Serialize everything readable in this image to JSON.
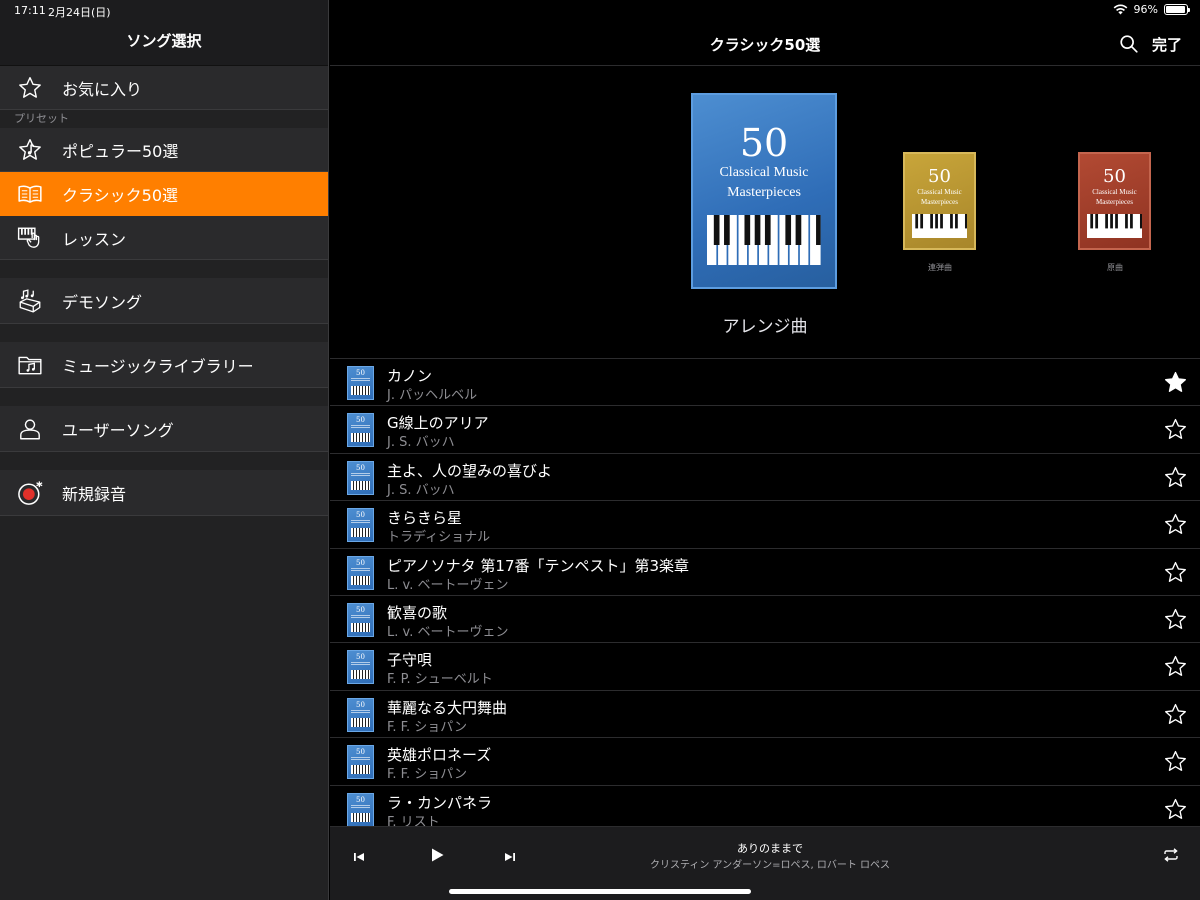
{
  "status": {
    "time": "17:11",
    "date": "2月24日(日)",
    "battery": "96%",
    "battery_level": 0.96
  },
  "sidebar": {
    "title": "ソング選択",
    "favorites": "お気に入り",
    "preset_section": "プリセット",
    "items": [
      {
        "label": "ポピュラー50選",
        "icon": "star-with-note-icon"
      },
      {
        "label": "クラシック50選",
        "icon": "book-icon",
        "active": true
      },
      {
        "label": "レッスン",
        "icon": "piano-hand-icon"
      },
      {
        "label": "デモソング",
        "icon": "music-notes-box-icon"
      },
      {
        "label": "ミュージックライブラリー",
        "icon": "folder-music-icon"
      },
      {
        "label": "ユーザーソング",
        "icon": "person-icon"
      },
      {
        "label": "新規録音",
        "icon": "record-icon"
      }
    ]
  },
  "main": {
    "title": "クラシック50選",
    "done_label": "完了",
    "accent_color": "#ff7f00",
    "albums": [
      {
        "num": "50",
        "line1": "Classical Music",
        "line2": "Masterpieces",
        "caption": ""
      },
      {
        "num": "50",
        "line1": "Classical Music",
        "line2": "Masterpieces",
        "caption": "連弾曲"
      },
      {
        "num": "50",
        "line1": "Classical Music",
        "line2": "Masterpieces",
        "caption": "原曲"
      }
    ],
    "selected_album_title": "アレンジ曲",
    "songs": [
      {
        "title": "カノン",
        "artist": "J. パッヘルベル",
        "favorite": true
      },
      {
        "title": "G線上のアリア",
        "artist": "J. S. バッハ",
        "favorite": false
      },
      {
        "title": "主よ、人の望みの喜びよ",
        "artist": "J. S. バッハ",
        "favorite": false
      },
      {
        "title": "きらきら星",
        "artist": "トラディショナル",
        "favorite": false
      },
      {
        "title": "ピアノソナタ 第17番「テンペスト」第3楽章",
        "artist": "L. v. ベートーヴェン",
        "favorite": false
      },
      {
        "title": "歓喜の歌",
        "artist": "L. v. ベートーヴェン",
        "favorite": false
      },
      {
        "title": "子守唄",
        "artist": "F. P. シューベルト",
        "favorite": false
      },
      {
        "title": "華麗なる大円舞曲",
        "artist": "F. F. ショパン",
        "favorite": false
      },
      {
        "title": "英雄ポロネーズ",
        "artist": "F. F. ショパン",
        "favorite": false
      },
      {
        "title": "ラ・カンパネラ",
        "artist": "F. リスト",
        "favorite": false
      }
    ]
  },
  "player": {
    "title": "ありのままで",
    "artist": "クリスティン アンダーソン=ロペス, ロバート ロペス"
  }
}
